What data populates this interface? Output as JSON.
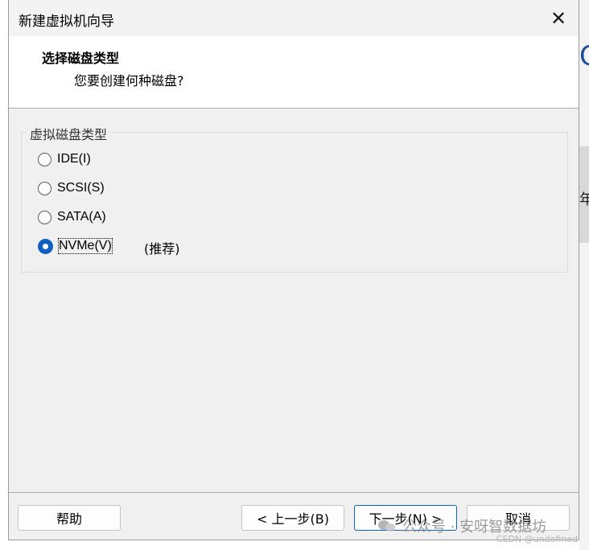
{
  "window": {
    "title": "新建虚拟机向导",
    "close_glyph": "✕"
  },
  "header": {
    "title": "选择磁盘类型",
    "subtitle": "您要创建何种磁盘?"
  },
  "group": {
    "label": "虚拟磁盘类型",
    "options": [
      {
        "label": "IDE(I)",
        "checked": false
      },
      {
        "label": "SCSI(S)",
        "checked": false
      },
      {
        "label": "SATA(A)",
        "checked": false
      },
      {
        "label": "NVMe(V)",
        "checked": true
      }
    ],
    "recommend": "(推荐)"
  },
  "buttons": {
    "help": "帮助",
    "back": "< 上一步(B)",
    "next": "下一步(N) >",
    "cancel": "取消"
  },
  "watermark": {
    "text": "公众号 · 安呀智数据坊",
    "csdn": "CSDN @undefined"
  },
  "background": {
    "partial_char": "年"
  },
  "colors": {
    "accent": "#0f5fc0",
    "dialog_bg": "#f0f0f0"
  }
}
